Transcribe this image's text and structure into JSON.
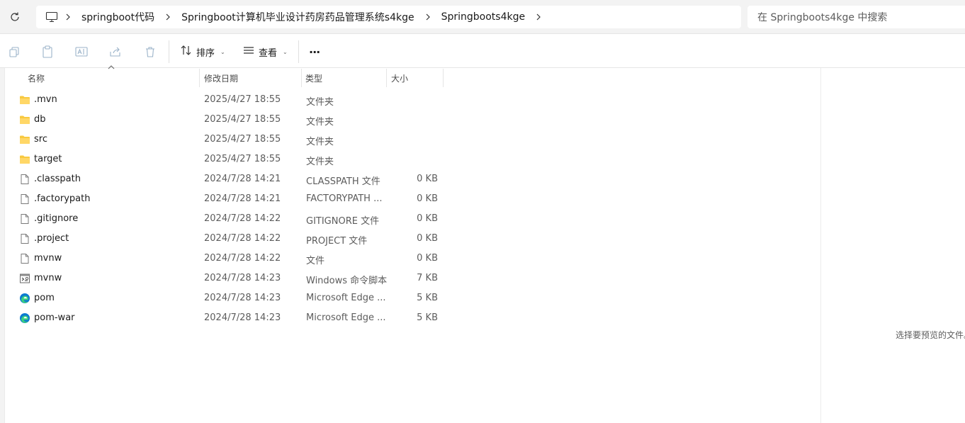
{
  "address_bar": {
    "breadcrumbs": [
      "springboot代码",
      "Springboot计算机毕业设计药房药品管理系统s4kge",
      "Springboots4kge"
    ],
    "search_placeholder": "在 Springboots4kge 中搜索"
  },
  "toolbar": {
    "icons": [
      "copy-icon",
      "paste-icon",
      "rename-icon",
      "share-icon",
      "delete-icon"
    ],
    "sort_label": "排序",
    "view_label": "查看",
    "more_label": "···"
  },
  "columns": {
    "name": "名称",
    "date": "修改日期",
    "type": "类型",
    "size": "大小"
  },
  "files": [
    {
      "name": ".mvn",
      "date": "2025/4/27 18:55",
      "type": "文件夹",
      "size": "",
      "icon": "folder-icon"
    },
    {
      "name": "db",
      "date": "2025/4/27 18:55",
      "type": "文件夹",
      "size": "",
      "icon": "folder-icon"
    },
    {
      "name": "src",
      "date": "2025/4/27 18:55",
      "type": "文件夹",
      "size": "",
      "icon": "folder-icon"
    },
    {
      "name": "target",
      "date": "2025/4/27 18:55",
      "type": "文件夹",
      "size": "",
      "icon": "folder-icon"
    },
    {
      "name": ".classpath",
      "date": "2024/7/28 14:21",
      "type": "CLASSPATH 文件",
      "size": "0 KB",
      "icon": "file-icon"
    },
    {
      "name": ".factorypath",
      "date": "2024/7/28 14:21",
      "type": "FACTORYPATH ...",
      "size": "0 KB",
      "icon": "file-icon"
    },
    {
      "name": ".gitignore",
      "date": "2024/7/28 14:22",
      "type": "GITIGNORE 文件",
      "size": "0 KB",
      "icon": "file-icon"
    },
    {
      "name": ".project",
      "date": "2024/7/28 14:22",
      "type": "PROJECT 文件",
      "size": "0 KB",
      "icon": "file-icon"
    },
    {
      "name": "mvnw",
      "date": "2024/7/28 14:22",
      "type": "文件",
      "size": "0 KB",
      "icon": "file-icon"
    },
    {
      "name": "mvnw",
      "date": "2024/7/28 14:23",
      "type": "Windows 命令脚本",
      "size": "7 KB",
      "icon": "script-icon"
    },
    {
      "name": "pom",
      "date": "2024/7/28 14:23",
      "type": "Microsoft Edge ...",
      "size": "5 KB",
      "icon": "edge-icon"
    },
    {
      "name": "pom-war",
      "date": "2024/7/28 14:23",
      "type": "Microsoft Edge ...",
      "size": "5 KB",
      "icon": "edge-icon"
    }
  ],
  "preview_pane": {
    "message": "选择要预览的文件。"
  }
}
